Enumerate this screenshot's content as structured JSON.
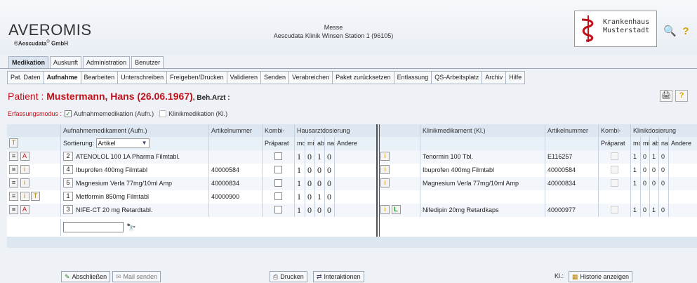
{
  "app": {
    "logo": "AVEROMIS",
    "copyright_prefix": "©Aescudata",
    "copyright_reg": "®",
    "copyright_suffix": " GmbH",
    "messe_line1": "Messe",
    "messe_line2": "Aescudata Klinik Winsen Station 1 (96105)",
    "hospital_line1": "Krankenhaus",
    "hospital_line2": "Musterstadt"
  },
  "colors": {
    "accent_red": "#c0121a",
    "header_bg": "#dde7f2",
    "nav_bg": "#d9e4f0"
  },
  "icons": {
    "search_top": "magnifier-icon",
    "help_top": "question-icon"
  },
  "nav_tabs": [
    "Medikation",
    "Auskunft",
    "Administration",
    "Benutzer"
  ],
  "sub_tabs": [
    "Pat. Daten",
    "Aufnahme",
    "Bearbeiten",
    "Unterschreiben",
    "Freigeben/Drucken",
    "Validieren",
    "Senden",
    "Verabreichen",
    "Paket zurücksetzen",
    "Entlassung",
    "QS-Arbeitsplatz",
    "Archiv",
    "Hilfe"
  ],
  "patient": {
    "label": "Patient : ",
    "name": "Mustermann, Hans (26.06.1967)",
    "arzt": ", Beh.Arzt :"
  },
  "mode": {
    "label": "Erfassungsmodus :",
    "opt1": "Aufnahmemedikation (Aufn.)",
    "opt2": "Klinikmedikation (Kl.)"
  },
  "table": {
    "headers": {
      "aufn": "Aufnahmemedikament (Aufn.)",
      "artnr": "Artikelnummer",
      "kombi": "Kombi-",
      "hausarzt": "Hausarztdosierung",
      "klinik": "Klinikmedikament (Kl.)",
      "artnr2": "Artikelnummer",
      "kombi2": "Kombi-",
      "klinikdos": "Klinikdosierung"
    },
    "sort_label": "Sortierung:",
    "sort_value": "Artikel",
    "praeparat": "Präparat",
    "dose_cols": [
      "mo",
      "mi",
      "ab",
      "na",
      "Andere"
    ],
    "dose_cols2": [
      "mo",
      "mi",
      "ab",
      "na",
      "Andere"
    ],
    "rows": [
      {
        "nr": "2",
        "aufn": "ATENOLOL 100 1A Pharma Filmtabl.",
        "artnr": "",
        "dose": [
          "1",
          "0",
          "1",
          "0"
        ],
        "klinik": "Tenormin 100 Tbl.",
        "artnr2": "E116257",
        "dose2": [
          "1",
          "0",
          "1",
          "0"
        ]
      },
      {
        "nr": "4",
        "aufn": "Ibuprofen 400mg Filmtabl",
        "artnr": "40000584",
        "dose": [
          "1",
          "0",
          "0",
          "0"
        ],
        "klinik": "Ibuprofen 400mg Filmtabl",
        "artnr2": "40000584",
        "dose2": [
          "1",
          "0",
          "0",
          "0"
        ]
      },
      {
        "nr": "5",
        "aufn": "Magnesium Verla 77mg/10ml Amp",
        "artnr": "40000834",
        "dose": [
          "1",
          "0",
          "0",
          "0"
        ],
        "klinik": "Magnesium Verla 77mg/10ml Amp",
        "artnr2": "40000834",
        "dose2": [
          "1",
          "0",
          "0",
          "0"
        ]
      },
      {
        "nr": "1",
        "aufn": "Metformin 850mg Filmtabl",
        "artnr": "40000900",
        "dose": [
          "1",
          "0",
          "1",
          "0"
        ],
        "klinik": "",
        "artnr2": "",
        "dose2": [
          "",
          "",
          "",
          ""
        ]
      },
      {
        "nr": "3",
        "aufn": "NIFE-CT 20 mg Retardtabl.",
        "artnr": "",
        "dose": [
          "1",
          "0",
          "0",
          "0"
        ],
        "klinik": "Nifedipin 20mg Retardkaps",
        "artnr2": "40000977",
        "dose2": [
          "1",
          "0",
          "1",
          "0"
        ]
      }
    ],
    "l_badge": "L"
  },
  "footer": {
    "abschliessen": "Abschließen",
    "mail": "Mail senden",
    "drucken": "Drucken",
    "interaktionen": "Interaktionen",
    "kl_label": "Kl.:",
    "historie": "Historie anzeigen"
  }
}
